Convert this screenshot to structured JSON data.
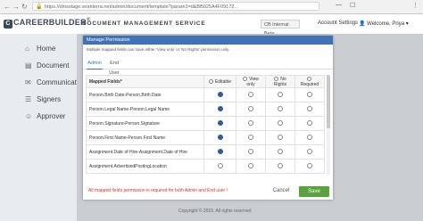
{
  "browser": {
    "url": "https://dmsstage.workterra.net/admin/document/template?param1=d&BB025A4F09172... ",
    "back": "←",
    "forward": "→",
    "refresh": "↻",
    "menu": "⋮"
  },
  "header": {
    "logo_text": "CAREERBUILDER",
    "logo_mark": "C",
    "logo_suffix": "®",
    "title": "DOCUMENT MANAGEMENT SERVICE",
    "env_select": "CB Internal Beta",
    "account_settings": "Account Settings",
    "welcome": "Welcome, Priya"
  },
  "sidebar": {
    "items": [
      {
        "label": "Home",
        "icon": "home-icon",
        "glyph": "⌂"
      },
      {
        "label": "Document",
        "icon": "document-icon",
        "glyph": "▤"
      },
      {
        "label": "Communication",
        "icon": "communication-icon",
        "glyph": "✉"
      },
      {
        "label": "Signers",
        "icon": "signers-icon",
        "glyph": "☰"
      },
      {
        "label": "Approver",
        "icon": "approver-icon",
        "glyph": "☺"
      }
    ]
  },
  "footer": {
    "copyright": "Copyright © 2015. All rights reserved"
  },
  "modal": {
    "title": "Manage Permission",
    "note": "Multiple mapped fields can have either 'View only' or 'No Rights' permission only.",
    "tabs": [
      "Admin",
      "End User"
    ],
    "columns": [
      "Mapped Fields*",
      "Editable",
      "View only",
      "No Rights",
      "Required"
    ],
    "rows": [
      {
        "field": "Person.Birth Date-Person.Birth Date",
        "selected": "Editable"
      },
      {
        "field": "Person.Legal Name-Person.Legal Name",
        "selected": "Editable"
      },
      {
        "field": "Person.Signature-Person.Signature",
        "selected": "Editable"
      },
      {
        "field": "Person.First Name-Person.First Name",
        "selected": "Editable"
      },
      {
        "field": "Assignment.Date of Hire-Assignment.Date of Hire",
        "selected": "Editable"
      },
      {
        "field": "Assignment.AdvertisedPostingLocation",
        "selected": ""
      }
    ],
    "error": "All mapped fields permission is required for both Admin and End user !",
    "cancel": "Cancel",
    "save": "Save"
  },
  "colors": {
    "modal_header": "#3f73b5",
    "save_button": "#5aa33c",
    "error_text": "#d9302b",
    "radio_selected": "#2d5d98"
  }
}
